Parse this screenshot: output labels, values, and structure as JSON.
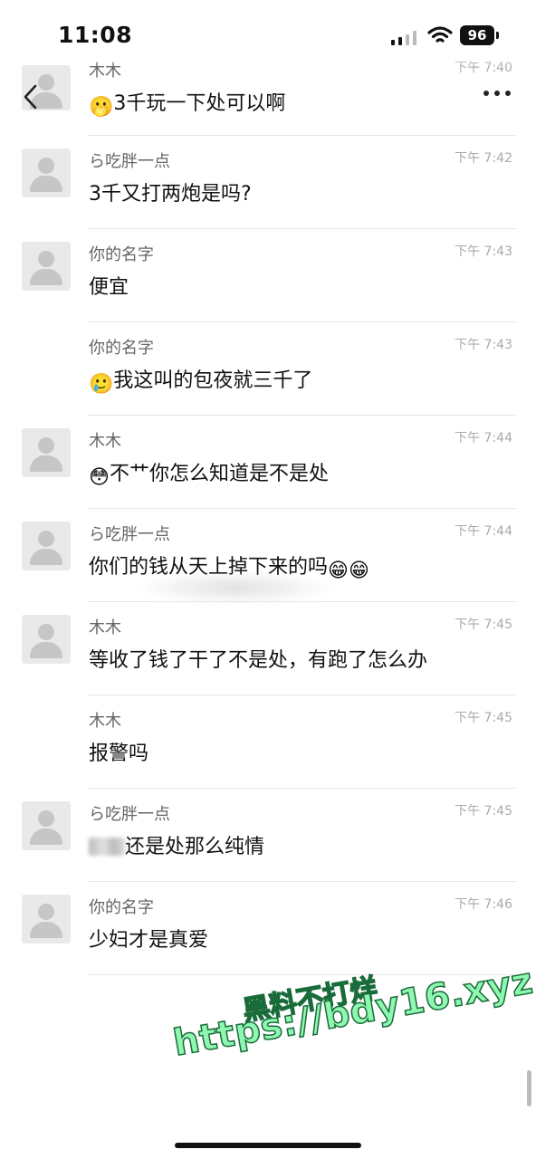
{
  "status_bar": {
    "time": "11:08",
    "battery": "96"
  },
  "messages": [
    {
      "name": "木木",
      "time": "下午 7:40",
      "emoji": "🫢",
      "text": "3千玩一下处可以啊",
      "avatar": true
    },
    {
      "name": "ら吃胖一点",
      "time": "下午 7:42",
      "emoji": "",
      "text": "3千又打两炮是吗?",
      "avatar": true
    },
    {
      "name": "你的名字",
      "time": "下午 7:43",
      "emoji": "",
      "text": "便宜",
      "avatar": true
    },
    {
      "name": "你的名字",
      "time": "下午 7:43",
      "emoji": "🥲",
      "text": "我这叫的包夜就三千了",
      "avatar": false
    },
    {
      "name": "木木",
      "time": "下午 7:44",
      "emoji": "😳",
      "text": "不艹你怎么知道是不是处",
      "avatar": true
    },
    {
      "name": "ら吃胖一点",
      "time": "下午 7:44",
      "emoji": "",
      "text": "你们的钱从天上掉下来的吗",
      "emoji_after": "😁😁",
      "avatar": true
    },
    {
      "name": "木木",
      "time": "下午 7:45",
      "emoji": "",
      "text": "等收了钱了干了不是处，有跑了怎么办",
      "avatar": true
    },
    {
      "name": "木木",
      "time": "下午 7:45",
      "emoji": "",
      "text": "报警吗",
      "avatar": false
    },
    {
      "name": "ら吃胖一点",
      "time": "下午 7:45",
      "emoji": "",
      "text": "还是处那么纯情",
      "blurred_prefix": true,
      "avatar": true
    },
    {
      "name": "你的名字",
      "time": "下午 7:46",
      "emoji": "",
      "text": "少妇才是真爱",
      "avatar": true
    }
  ],
  "watermark": {
    "line1": "黑料不打烊",
    "line2": "https://bdy16.xyz"
  },
  "colors": {
    "watermark_fill": "#8ef7b0",
    "watermark_stroke": "#1a6b3a",
    "divider": "#e6e6e6"
  }
}
